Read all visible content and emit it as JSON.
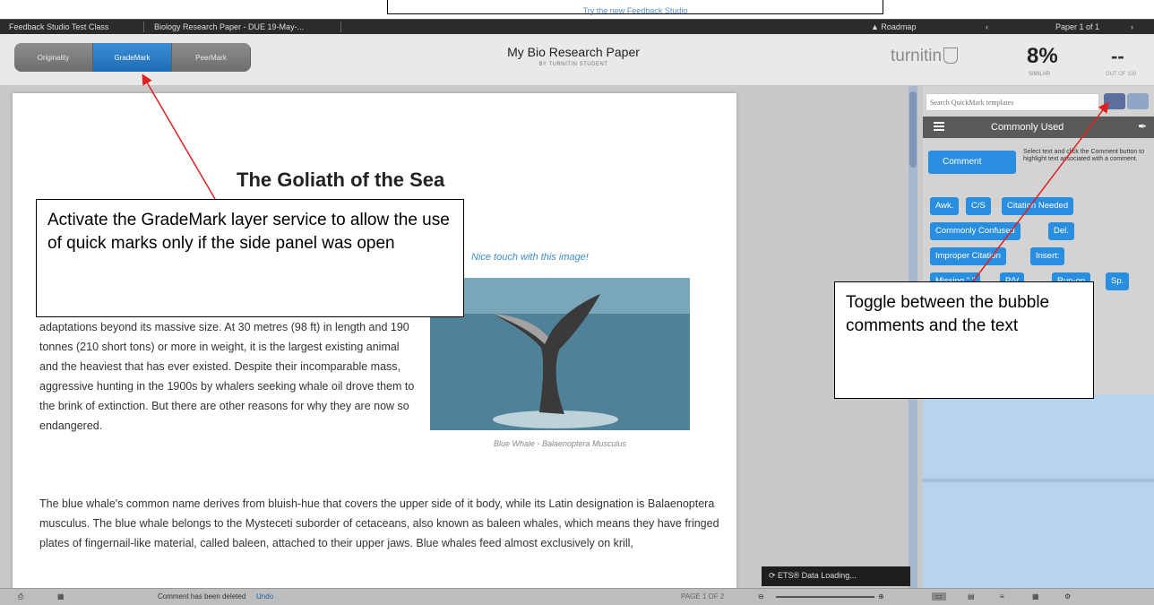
{
  "banner": {
    "link_text": "Try the new Feedback Studio"
  },
  "nav": {
    "class_name": "Feedback Studio Test Class",
    "assignment": "Biology Research Paper - DUE 19-May-...",
    "roadmap": "Roadmap",
    "paper_count": "Paper 1 of 1"
  },
  "header": {
    "tabs": [
      {
        "label": "Originality"
      },
      {
        "label": "GradeMark"
      },
      {
        "label": "PeerMark"
      }
    ],
    "title": "My Bio Research Paper",
    "subtitle": "BY TURNITIN STUDENT",
    "logo": "turnitin",
    "similarity": {
      "value": "8%",
      "label": "SIMILAR"
    },
    "grade": {
      "value": "--",
      "label": "OUT OF 100"
    }
  },
  "document": {
    "heading": "The Goliath of the Sea",
    "bubble_comment": "Nice touch with this image!",
    "image_caption": "Blue Whale - Balaenoptera Musculus",
    "paragraph1": "adaptations beyond its massive size. At 30 metres (98 ft) in length and 190 tonnes (210 short tons) or more in weight, it is the largest existing animal and the heaviest that has ever existed. Despite their incomparable mass, aggressive hunting in the 1900s by whalers seeking whale oil drove them to the brink of extinction. But there are other reasons for why they are now so endangered.",
    "paragraph2": "The blue whale's common name derives from bluish-hue that covers the upper side of it body, while its Latin designation is Balaenoptera musculus. The blue whale belongs to the Mysteceti suborder of cetaceans, also known as baleen whales, which means they have fringed plates of fingernail-like material, called baleen, attached to their upper jaws. Blue whales feed almost exclusively on krill,"
  },
  "side_panel": {
    "search_placeholder": "Search QuickMark templates",
    "set_name": "Commonly Used",
    "comment_button": "Comment",
    "comment_help": "Select text and click the Comment button to highlight text associated with a comment.",
    "tags": [
      "Awk.",
      "C/S",
      "Citation Needed",
      "Commonly Confused",
      "Del.",
      "Improper Citation",
      "Insert:",
      "Missing \",\"",
      "P/V",
      "Run-on",
      "Sp."
    ]
  },
  "status": {
    "message": "Comment has been deleted",
    "undo": "Undo",
    "page_indicator": "PAGE 1 OF 2",
    "loading": "ETS® Data Loading..."
  },
  "callouts": {
    "left": "Activate the GradeMark layer service to allow the use of quick marks only if the side panel was open",
    "right": "Toggle between the bubble comments and the text"
  },
  "colors": {
    "accent_blue": "#2a8ee0",
    "annotation_arrow": "#e0201e",
    "toolbar_dark": "#2b2b2b"
  }
}
